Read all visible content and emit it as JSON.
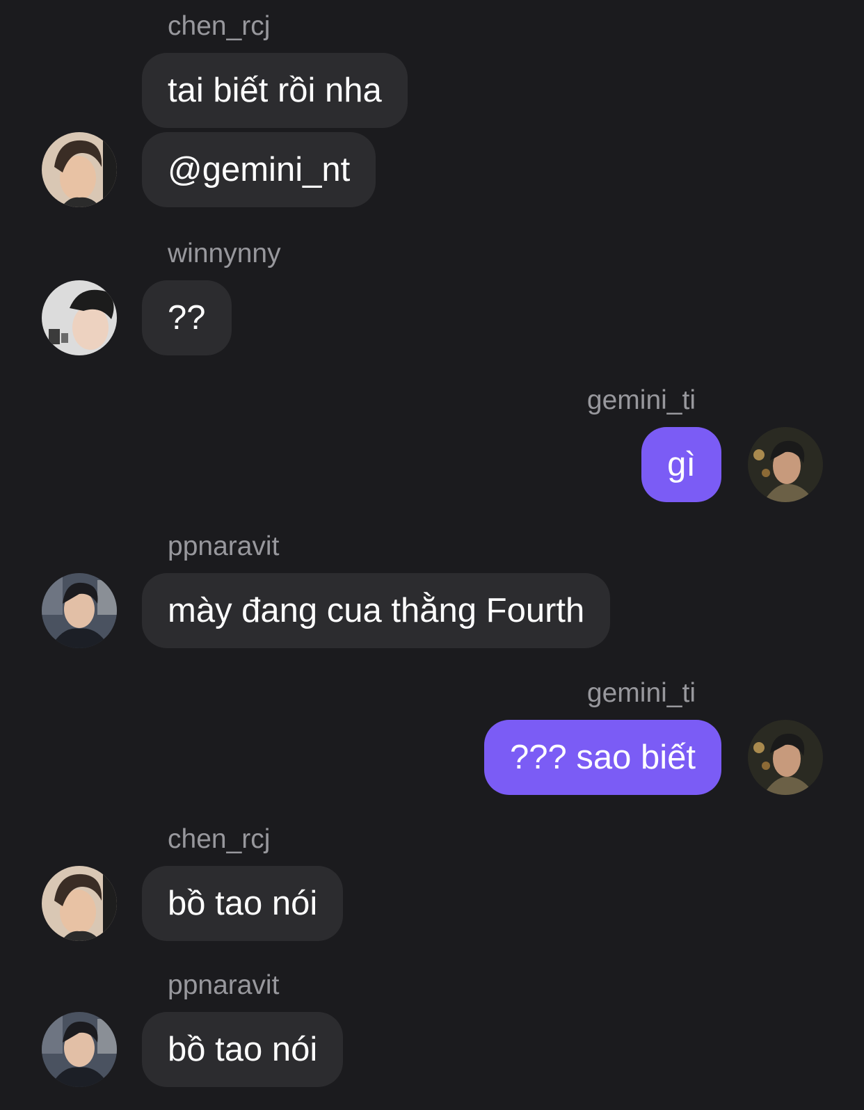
{
  "messages": [
    {
      "user": "chen_rcj",
      "texts": [
        "tai biết rồi nha",
        "@gemini_nt"
      ]
    },
    {
      "user": "winnynny",
      "texts": [
        "??"
      ]
    },
    {
      "user": "gemini_ti",
      "texts": [
        "gì"
      ]
    },
    {
      "user": "ppnaravit",
      "texts": [
        "mày đang cua thằng Fourth"
      ]
    },
    {
      "user": "gemini_ti",
      "texts": [
        "??? sao biết"
      ]
    },
    {
      "user": "chen_rcj",
      "texts": [
        "bồ tao nói"
      ]
    },
    {
      "user": "ppnaravit",
      "texts": [
        "bồ tao nói"
      ]
    }
  ],
  "colors": {
    "background": "#1b1b1e",
    "incoming_bubble": "#2c2c2f",
    "outgoing_bubble": "#7b5cf5",
    "username": "#98989d",
    "text": "#ffffff"
  }
}
